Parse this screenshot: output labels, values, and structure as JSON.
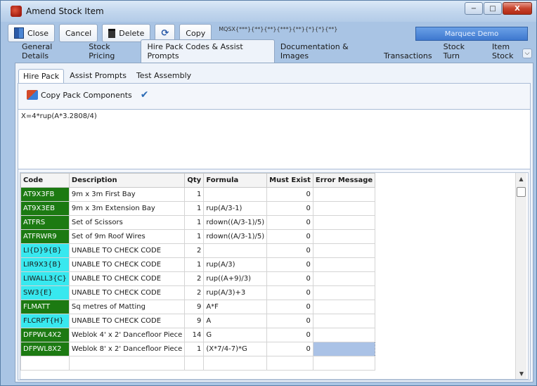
{
  "window": {
    "title": "Amend Stock Item",
    "buttons": {
      "minimize": "−",
      "maximize": "□",
      "close": "X"
    }
  },
  "toolbar": {
    "close_label": "Close",
    "cancel_label": "Cancel",
    "delete_label": "Delete",
    "copy_label": "Copy",
    "item_code": "MQSX{***}{**}{**}{***}{**}{*}{*}{**}",
    "company": "Marquee Demo"
  },
  "main_tabs": [
    "General Details",
    "Stock Pricing",
    "Hire Pack Codes & Assist Prompts",
    "Documentation & Images",
    "Transactions",
    "Stock Turn",
    "Item Stock"
  ],
  "sub_tabs": [
    "Hire Pack",
    "Assist Prompts",
    "Test Assembly"
  ],
  "actions": {
    "copy_pack_label": "Copy Pack Components"
  },
  "formula_text": "X=4*rup(A*3.2808/4)",
  "grid": {
    "headers": [
      "Code",
      "Description",
      "Qty",
      "Formula",
      "Must Exist",
      "Error Message"
    ],
    "rows": [
      {
        "code": "AT9X3FB",
        "code_color": "green",
        "description": "9m x 3m First Bay",
        "qty": "1",
        "formula": "",
        "must_exist": "0",
        "error": ""
      },
      {
        "code": "AT9X3EB",
        "code_color": "green",
        "description": "9m x 3m Extension Bay",
        "qty": "1",
        "formula": "rup(A/3-1)",
        "must_exist": "0",
        "error": ""
      },
      {
        "code": "ATFRS",
        "code_color": "green",
        "description": "Set of Scissors",
        "qty": "1",
        "formula": "rdown((A/3-1)/5)",
        "must_exist": "0",
        "error": ""
      },
      {
        "code": "ATFRWR9",
        "code_color": "green",
        "description": "Set of 9m Roof Wires",
        "qty": "1",
        "formula": "rdown((A/3-1)/5)",
        "must_exist": "0",
        "error": ""
      },
      {
        "code": "LI{D}9{B}",
        "code_color": "cyan",
        "description": "UNABLE TO CHECK CODE",
        "qty": "2",
        "formula": "",
        "must_exist": "0",
        "error": ""
      },
      {
        "code": "LIR9X3{B}",
        "code_color": "cyan",
        "description": "UNABLE TO CHECK CODE",
        "qty": "1",
        "formula": "rup(A/3)",
        "must_exist": "0",
        "error": ""
      },
      {
        "code": "LIWALL3{C}",
        "code_color": "cyan",
        "description": "UNABLE TO CHECK CODE",
        "qty": "2",
        "formula": "rup((A+9)/3)",
        "must_exist": "0",
        "error": ""
      },
      {
        "code": "SW3{E}",
        "code_color": "cyan",
        "description": "UNABLE TO CHECK CODE",
        "qty": "2",
        "formula": "rup(A/3)+3",
        "must_exist": "0",
        "error": ""
      },
      {
        "code": "FLMATT",
        "code_color": "green",
        "description": "Sq metres of Matting",
        "qty": "9",
        "formula": "A*F",
        "must_exist": "0",
        "error": ""
      },
      {
        "code": "FLCRPT{H}",
        "code_color": "cyan",
        "description": "UNABLE TO CHECK CODE",
        "qty": "9",
        "formula": "A",
        "must_exist": "0",
        "error": ""
      },
      {
        "code": "DFPWL4X2",
        "code_color": "green",
        "description": "Weblok 4' x 2' Dancefloor Piece",
        "qty": "14",
        "formula": "G",
        "must_exist": "0",
        "error": ""
      },
      {
        "code": "DFPWL8X2",
        "code_color": "green",
        "description": "Weblok 8' x 2' Dancefloor Piece",
        "qty": "1",
        "formula": "(X*7/4-7)*G",
        "must_exist": "0",
        "error": ""
      },
      {
        "code": "",
        "code_color": "none",
        "description": "",
        "qty": "",
        "formula": "",
        "must_exist": "",
        "error": ""
      }
    ]
  },
  "colors": {
    "green": "#1c7a12",
    "cyan": "#38e8ef",
    "selection": "#aac2e6"
  }
}
